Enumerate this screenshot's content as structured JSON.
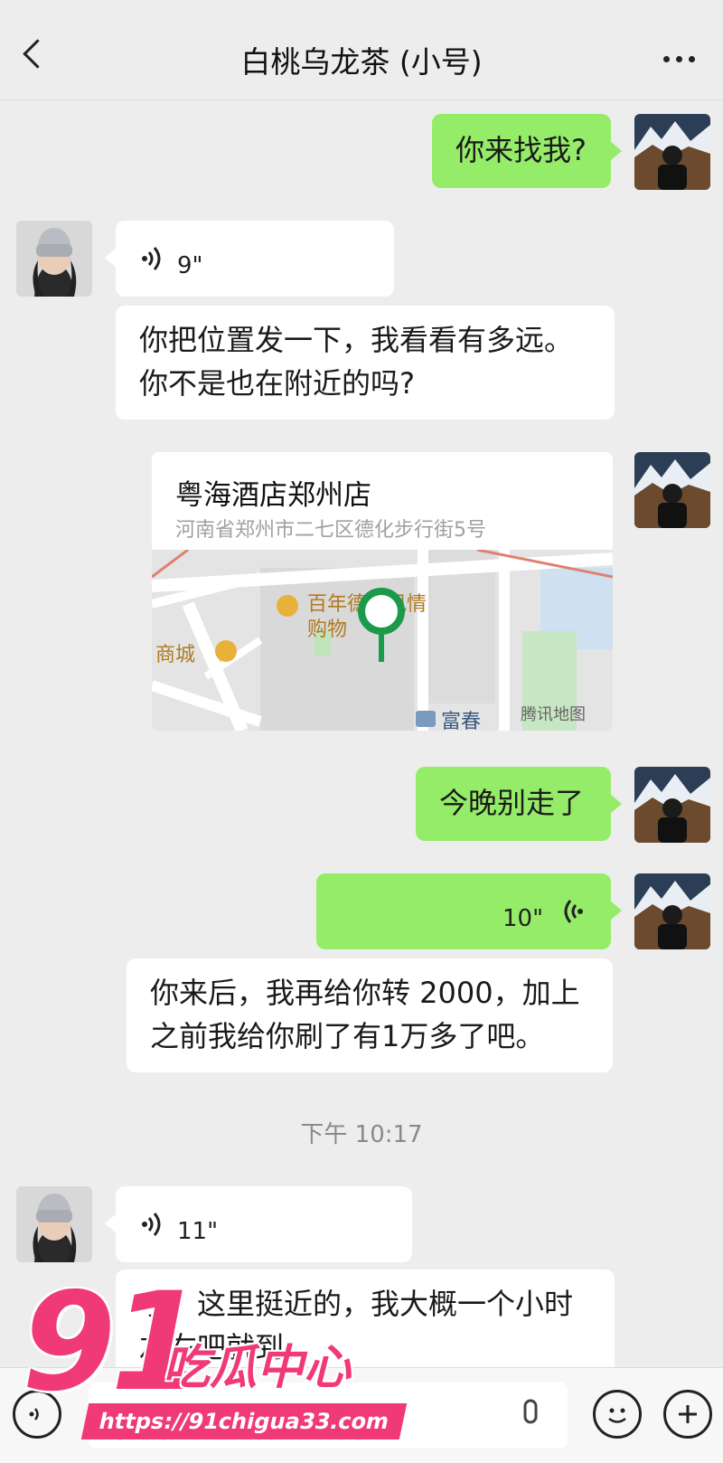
{
  "header": {
    "title": "白桃乌龙茶 (小号)"
  },
  "messages": {
    "m1_text": "你来找我?",
    "m2_voice": "9\"",
    "m3_text_line1": "你把位置发一下，我看看有多远。",
    "m3_text_line2": "你不是也在附近的吗?",
    "m4_location": {
      "name": "粤海酒店郑州店",
      "address": "河南省郑州市二七区德化步行街5号",
      "map_labels": [
        "百年德化风情",
        "购物",
        "商城",
        "富春",
        "腾讯地图"
      ]
    },
    "m5_text": "今晚别走了",
    "m6_voice": "10\"",
    "m7_text_line1": "你来后，我再给你转 2000，加上",
    "m7_text_line2": "之前我给你刷了有1万多了吧。",
    "timestamp": "下午 10:17",
    "m8_voice": "11\"",
    "m9_text_line1": "哦，这里挺近的，我大概一个小时",
    "m9_text_line2": "左右吧就到。"
  },
  "watermark": {
    "number": "91",
    "name": "吃瓜中心",
    "url": "https://91chigua33.com"
  },
  "colors": {
    "background": "#ededed",
    "bubble_out": "#95ec69",
    "bubble_in": "#ffffff",
    "watermark": "#f03a78"
  },
  "icons": [
    "back-icon",
    "more-icon",
    "voice-icon",
    "map-pin-icon",
    "voice-mode-icon",
    "emoji-icon",
    "plus-icon"
  ]
}
